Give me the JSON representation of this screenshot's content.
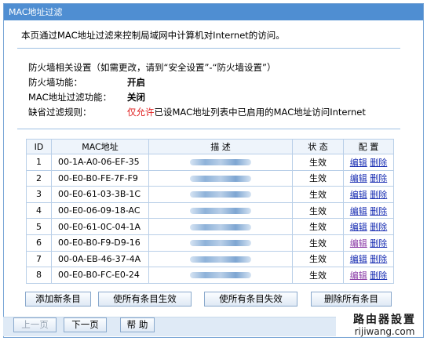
{
  "window": {
    "title": "MAC地址过滤"
  },
  "intro": "本页通过MAC地址过滤来控制局域网中计算机对Internet的访问。",
  "settings": {
    "note": "防火墙相关设置（如需更改，请到“安全设置”-“防火墙设置”）",
    "firewall_label": "防火墙功能：",
    "firewall_value": "开启",
    "macfilter_label": "MAC地址过滤功能：",
    "macfilter_value": "关闭",
    "default_rule_label": "缺省过滤规则：",
    "default_rule_highlight": "仅允许",
    "default_rule_text": "已设MAC地址列表中已启用的MAC地址访问Internet"
  },
  "table": {
    "headers": {
      "id": "ID",
      "mac": "MAC地址",
      "desc": "描 述",
      "status": "状 态",
      "config": "配 置"
    },
    "edit_label": "编辑",
    "delete_label": "删除",
    "rows": [
      {
        "id": "1",
        "mac": "00-1A-A0-06-EF-35",
        "status": "生效"
      },
      {
        "id": "2",
        "mac": "00-E0-B0-FE-7F-F9",
        "status": "生效"
      },
      {
        "id": "3",
        "mac": "00-E0-61-03-3B-1C",
        "status": "生效"
      },
      {
        "id": "4",
        "mac": "00-E0-06-09-18-AC",
        "status": "生效"
      },
      {
        "id": "5",
        "mac": "00-E0-61-0C-04-1A",
        "status": "生效"
      },
      {
        "id": "6",
        "mac": "00-E0-B0-F9-D9-16",
        "status": "生效"
      },
      {
        "id": "7",
        "mac": "00-0A-EB-46-37-4A",
        "status": "生效"
      },
      {
        "id": "8",
        "mac": "00-E0-B0-FC-E0-24",
        "status": "生效"
      }
    ]
  },
  "actions": {
    "add": "添加新条目",
    "enable_all": "使所有条目生效",
    "disable_all": "使所有条目失效",
    "delete_all": "删除所有条目"
  },
  "nav": {
    "prev": "上一页",
    "next": "下一页",
    "help": "帮 助"
  },
  "watermark": {
    "line1": "路由器設置",
    "line2": "rijiwang.com"
  },
  "colors": {
    "titlebar": "#4f8ed2",
    "highlight": "#e02020",
    "link": "#1a2fb3"
  }
}
